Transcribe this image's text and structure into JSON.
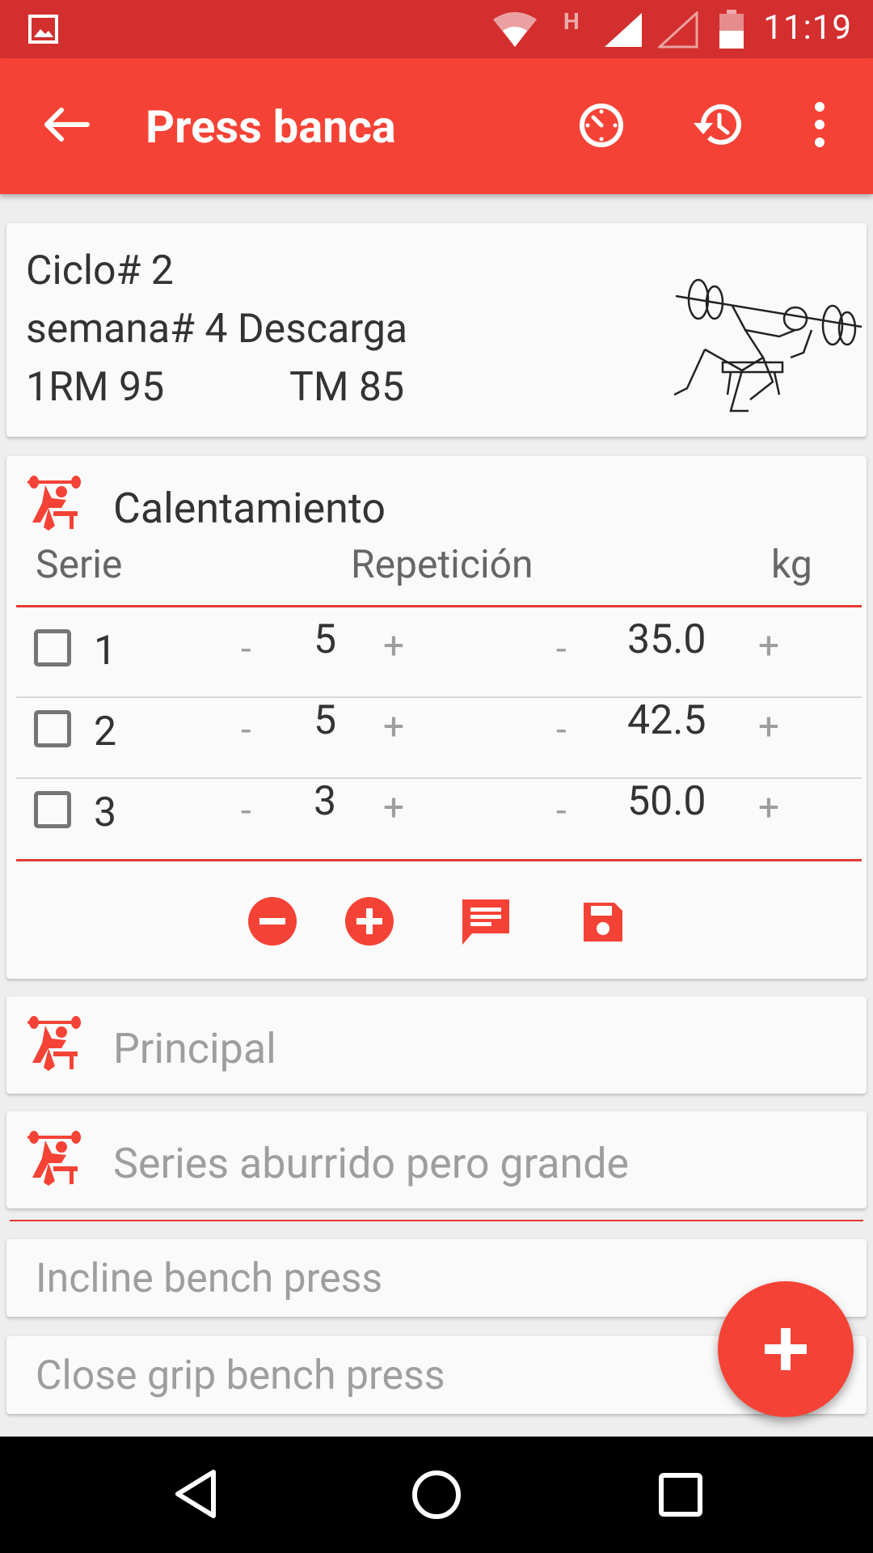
{
  "status_bar": {
    "time": "11:19",
    "network": "H"
  },
  "app_bar": {
    "title": "Press banca"
  },
  "info": {
    "cycle": "Ciclo# 2",
    "week": "semana# 4 Descarga",
    "one_rm": "1RM 95",
    "tm": "TM 85"
  },
  "warmup": {
    "title": "Calentamiento",
    "headers": {
      "serie": "Serie",
      "reps": "Repetición",
      "kg": "kg"
    },
    "rows": [
      {
        "set": "1",
        "reps": "5",
        "kg": "35.0",
        "minus": "-",
        "plus": "+"
      },
      {
        "set": "2",
        "reps": "5",
        "kg": "42.5",
        "minus": "-",
        "plus": "+"
      },
      {
        "set": "3",
        "reps": "3",
        "kg": "50.0",
        "minus": "-",
        "plus": "+"
      }
    ]
  },
  "sections": [
    {
      "title": "Principal"
    },
    {
      "title": "Series aburrido pero grande"
    }
  ],
  "accessories": [
    {
      "title": "Incline bench press"
    },
    {
      "title": "Close grip bench press"
    }
  ],
  "colors": {
    "primary": "#f44336",
    "primary_dark": "#d32f2f",
    "accent": "#e53935"
  }
}
